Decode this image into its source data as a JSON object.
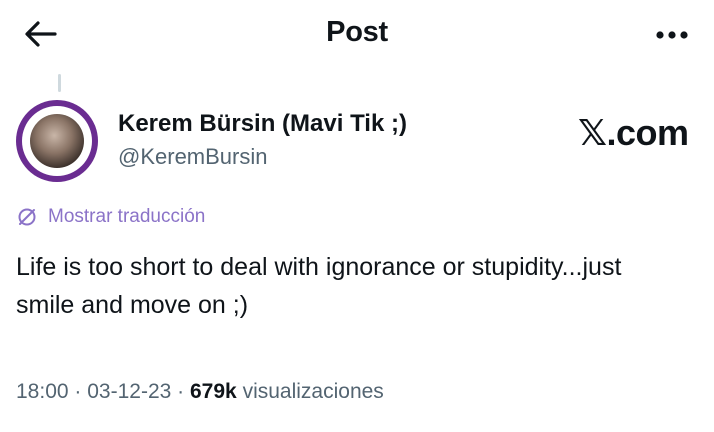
{
  "header": {
    "title": "Post",
    "back_icon": "arrow-left-icon",
    "more_icon": "more-horizontal-icon"
  },
  "author": {
    "display_name": "Kerem Bürsin (Mavi Tik ;)",
    "handle": "@KeremBursin"
  },
  "watermark": "𝕏.com",
  "translate": {
    "icon": "globe-slash-icon",
    "label": "Mostrar traducción"
  },
  "tweet": {
    "text": "Life is too short to deal with ignorance or stupidity...just smile and move on ;)"
  },
  "meta": {
    "time": "18:00",
    "separator": "·",
    "date": "03-12-23",
    "views_count": "679k",
    "views_label": "visualizaciones"
  },
  "colors": {
    "text_primary": "#0f1419",
    "text_secondary": "#536471",
    "translate_accent": "#8b73c8",
    "avatar_ring": "#6a2c91"
  }
}
